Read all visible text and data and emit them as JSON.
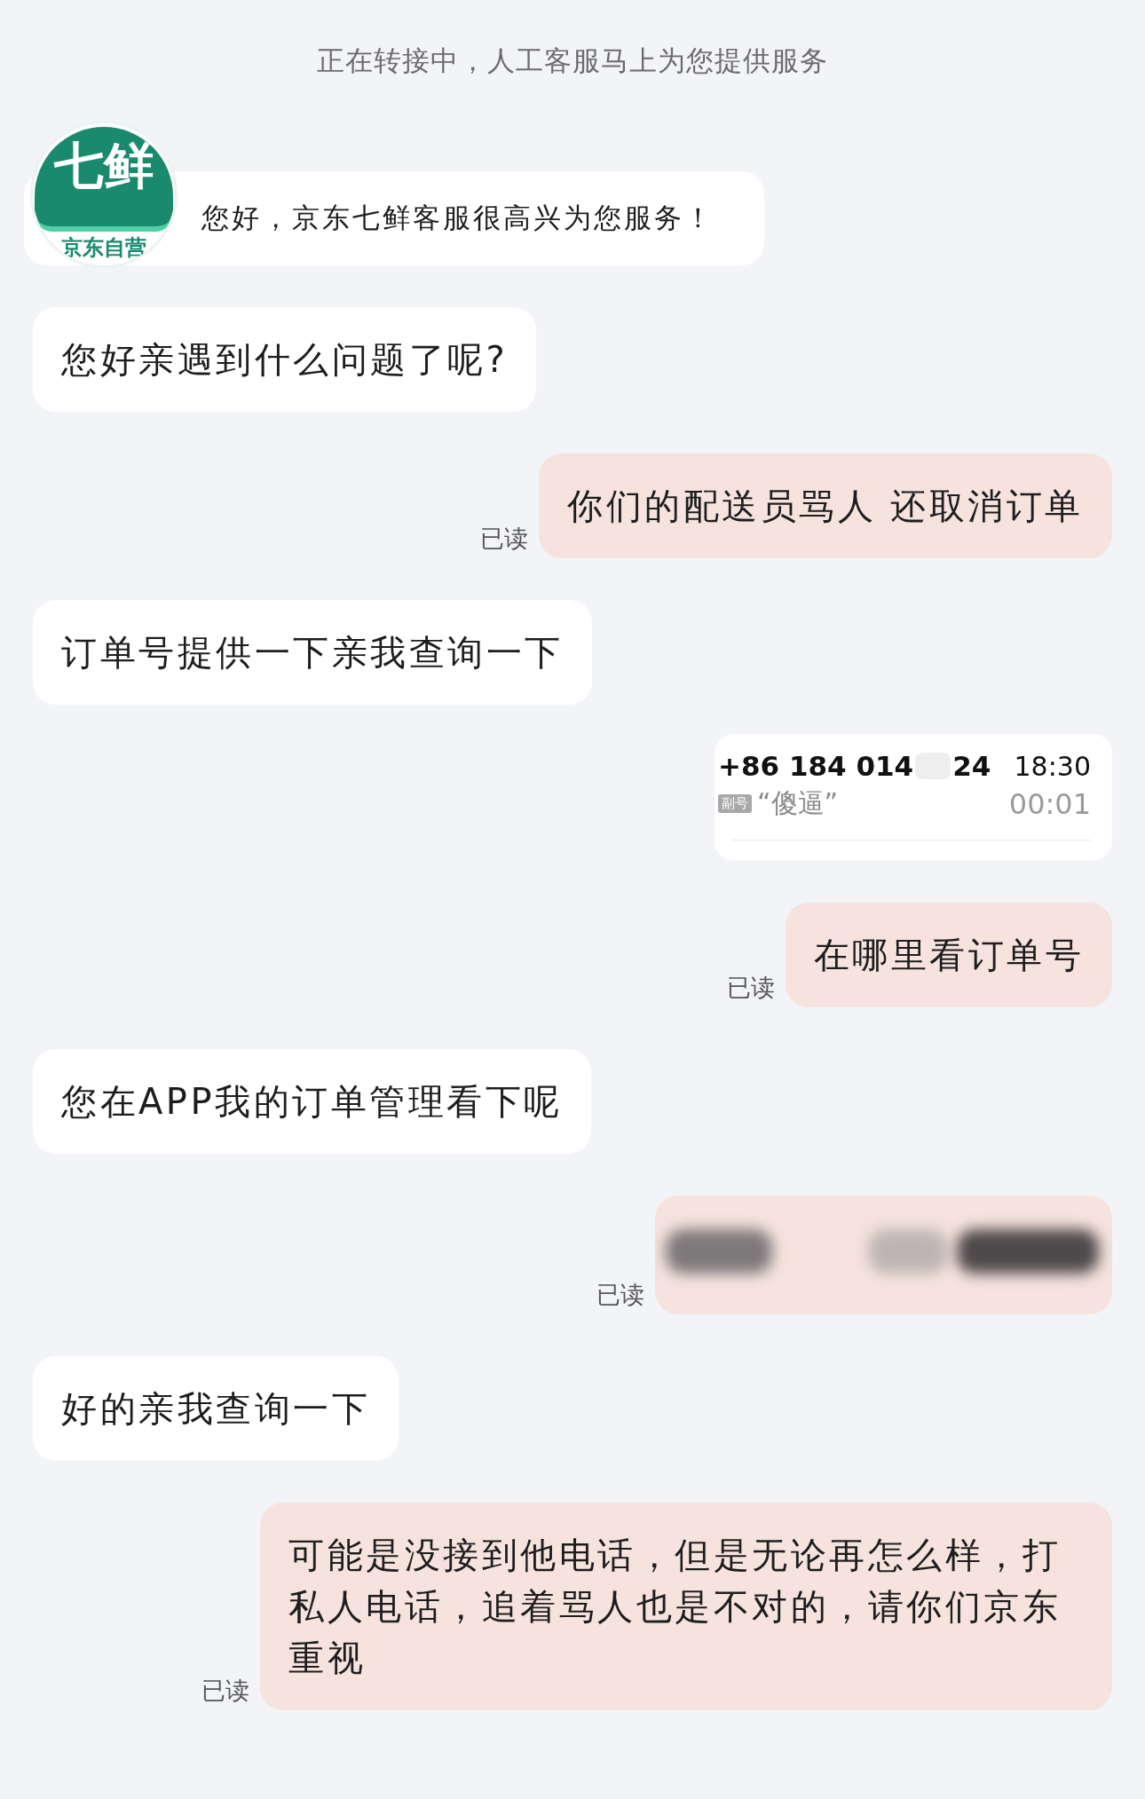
{
  "system_notice": "正在转接中，人工客服马上为您提供服务",
  "messages": [
    {
      "kind": "greeting",
      "outgoing": false,
      "avatar": {
        "title": "七鲜",
        "subtitle": "京东自营"
      },
      "text": "您好，京东七鲜客服很高兴为您服务！"
    },
    {
      "kind": "text",
      "outgoing": false,
      "text": "您好亲遇到什么问题了呢?"
    },
    {
      "kind": "text",
      "outgoing": true,
      "text": "你们的配送员骂人 还取消订单",
      "receipt": "已读"
    },
    {
      "kind": "text",
      "outgoing": false,
      "text": "订单号提供一下亲我查询一下"
    },
    {
      "kind": "call_card",
      "outgoing": true,
      "number_start": "+86 184 014",
      "number_end": "24",
      "time": "18:30",
      "tag": "副号",
      "contact": "“傻逼”",
      "duration": "00:01"
    },
    {
      "kind": "text",
      "outgoing": true,
      "text": "在哪里看订单号",
      "receipt": "已读"
    },
    {
      "kind": "text",
      "outgoing": false,
      "text": "您在APP我的订单管理看下呢"
    },
    {
      "kind": "redacted",
      "outgoing": true,
      "receipt": "已读"
    },
    {
      "kind": "text",
      "outgoing": false,
      "text": "好的亲我查询一下"
    },
    {
      "kind": "text",
      "outgoing": true,
      "text": "可能是没接到他电话，但是无论再怎么样，打私人电话，追着骂人也是不对的，请你们京东重视",
      "receipt": "已读"
    }
  ]
}
